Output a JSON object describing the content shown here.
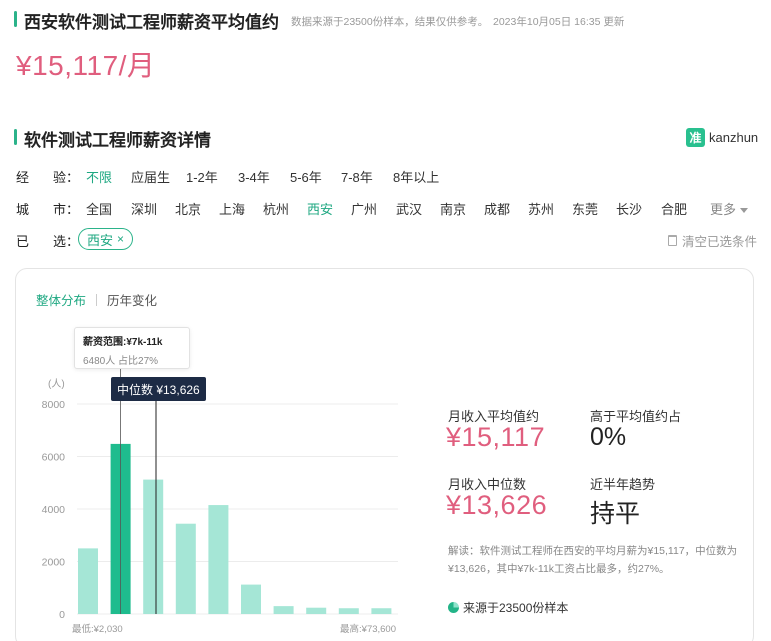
{
  "header": {
    "title": "西安软件测试工程师薪资平均值约",
    "source_note": "数据来源于23500份样本，结果仅供参考。",
    "updated": "2023年10月05日 16:35 更新",
    "avg_salary": "¥15,117/月"
  },
  "section": {
    "title": "软件测试工程师薪资详情",
    "logo_mark": "准",
    "logo_text": "kanzhun"
  },
  "filters": {
    "experience": {
      "label_a": "经",
      "label_b": "验：",
      "options": [
        "不限",
        "应届生",
        "1-2年",
        "3-4年",
        "5-6年",
        "7-8年",
        "8年以上"
      ],
      "selected": "不限"
    },
    "city": {
      "label_a": "城",
      "label_b": "市：",
      "options": [
        "全国",
        "深圳",
        "北京",
        "上海",
        "杭州",
        "西安",
        "广州",
        "武汉",
        "南京",
        "成都",
        "苏州",
        "东莞",
        "长沙",
        "合肥"
      ],
      "selected": "西安",
      "more_label": "更多"
    },
    "selected_row": {
      "label_a": "已",
      "label_b": "选：",
      "chip": "西安",
      "chip_close": "×",
      "clear_label": "清空已选条件"
    }
  },
  "tabs": [
    {
      "label": "整体分布",
      "active": true
    },
    {
      "label": "历年变化",
      "active": false
    }
  ],
  "tooltip": {
    "range": "薪资范围:¥7k-11k",
    "detail": "6480人  占比27%"
  },
  "median_tag": "中位数 ¥13,626",
  "chart_data": {
    "type": "bar",
    "ylabel": "(人)",
    "ylim": [
      0,
      8000
    ],
    "yticks": [
      0,
      2000,
      4000,
      6000,
      8000
    ],
    "values": [
      2500,
      6480,
      5120,
      3440,
      4150,
      1120,
      300,
      240,
      220,
      220
    ],
    "highlight_index": 1,
    "median_salary": 13626,
    "x_min_label": "最低:¥2,030",
    "x_max_label": "最高:¥73,600",
    "colors": {
      "bar": "#a5e6d6",
      "highlight": "#1fbc8e",
      "grid": "#ececec"
    }
  },
  "stats": {
    "avg_label": "月收入平均值约",
    "avg_value": "¥15,117",
    "above_label": "高于平均值约占",
    "above_value": "0%",
    "median_label": "月收入中位数",
    "median_value": "¥13,626",
    "trend_label": "近半年趋势",
    "trend_value": "持平"
  },
  "note": "解读：软件测试工程师在西安的平均月薪为¥15,117，中位数为¥13,626，其中¥7k-11k工资占比最多，约27%。",
  "source": "来源于23500份样本"
}
